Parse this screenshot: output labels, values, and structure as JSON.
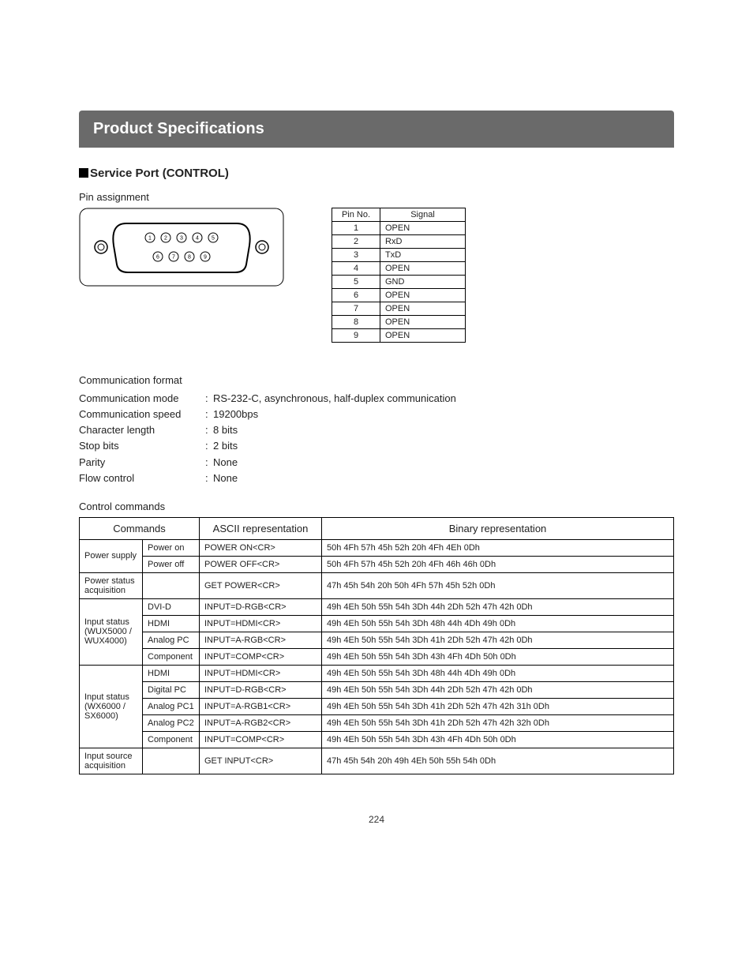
{
  "title": "Product Specifications",
  "section": "Service Port (CONTROL)",
  "pinAssignment": {
    "heading": "Pin assignment",
    "headers": {
      "pin": "Pin No.",
      "signal": "Signal"
    },
    "rows": [
      {
        "pin": "1",
        "signal": "OPEN"
      },
      {
        "pin": "2",
        "signal": "RxD"
      },
      {
        "pin": "3",
        "signal": "TxD"
      },
      {
        "pin": "4",
        "signal": "OPEN"
      },
      {
        "pin": "5",
        "signal": "GND"
      },
      {
        "pin": "6",
        "signal": "OPEN"
      },
      {
        "pin": "7",
        "signal": "OPEN"
      },
      {
        "pin": "8",
        "signal": "OPEN"
      },
      {
        "pin": "9",
        "signal": "OPEN"
      }
    ]
  },
  "commFormat": {
    "heading": "Communication format",
    "rows": [
      {
        "label": "Communication mode",
        "value": "RS-232-C, asynchronous, half-duplex communication"
      },
      {
        "label": "Communication speed",
        "value": "19200bps"
      },
      {
        "label": "Character length",
        "value": "8 bits"
      },
      {
        "label": "Stop bits",
        "value": "2 bits"
      },
      {
        "label": "Parity",
        "value": "None"
      },
      {
        "label": "Flow control",
        "value": "None"
      }
    ]
  },
  "controlCommands": {
    "heading": "Control commands",
    "headers": {
      "commands": "Commands",
      "ascii": "ASCII representation",
      "binary": "Binary representation"
    },
    "groups": [
      {
        "category": "Power supply",
        "rows": [
          {
            "sub": "Power on",
            "ascii": "POWER ON<CR>",
            "binary": "50h 4Fh 57h 45h 52h 20h 4Fh 4Eh 0Dh"
          },
          {
            "sub": "Power off",
            "ascii": "POWER OFF<CR>",
            "binary": "50h 4Fh 57h 45h 52h 20h 4Fh 46h 46h 0Dh"
          }
        ]
      },
      {
        "category": "Power status acquisition",
        "rows": [
          {
            "sub": "",
            "ascii": "GET POWER<CR>",
            "binary": "47h 45h 54h 20h 50h 4Fh 57h 45h 52h 0Dh"
          }
        ]
      },
      {
        "category": "Input status (WUX5000 / WUX4000)",
        "rows": [
          {
            "sub": "DVI-D",
            "ascii": "INPUT=D-RGB<CR>",
            "binary": "49h 4Eh 50h 55h 54h 3Dh 44h 2Dh 52h 47h 42h 0Dh"
          },
          {
            "sub": "HDMI",
            "ascii": "INPUT=HDMI<CR>",
            "binary": "49h 4Eh 50h 55h 54h 3Dh 48h 44h 4Dh 49h 0Dh"
          },
          {
            "sub": "Analog PC",
            "ascii": "INPUT=A-RGB<CR>",
            "binary": "49h 4Eh 50h 55h 54h 3Dh 41h 2Dh 52h 47h 42h 0Dh"
          },
          {
            "sub": "Component",
            "ascii": "INPUT=COMP<CR>",
            "binary": "49h 4Eh 50h 55h 54h 3Dh 43h 4Fh 4Dh 50h 0Dh"
          }
        ]
      },
      {
        "category": "Input status (WX6000 / SX6000)",
        "rows": [
          {
            "sub": "HDMI",
            "ascii": "INPUT=HDMI<CR>",
            "binary": "49h 4Eh 50h 55h 54h 3Dh 48h 44h 4Dh 49h 0Dh"
          },
          {
            "sub": "Digital PC",
            "ascii": "INPUT=D-RGB<CR>",
            "binary": "49h 4Eh 50h 55h 54h 3Dh 44h 2Dh 52h 47h 42h 0Dh"
          },
          {
            "sub": "Analog PC1",
            "ascii": "INPUT=A-RGB1<CR>",
            "binary": "49h 4Eh 50h 55h 54h 3Dh 41h 2Dh 52h 47h 42h 31h 0Dh"
          },
          {
            "sub": "Analog PC2",
            "ascii": "INPUT=A-RGB2<CR>",
            "binary": "49h 4Eh 50h 55h 54h 3Dh 41h 2Dh 52h 47h 42h 32h 0Dh"
          },
          {
            "sub": "Component",
            "ascii": "INPUT=COMP<CR>",
            "binary": "49h 4Eh 50h 55h 54h 3Dh 43h 4Fh 4Dh 50h 0Dh"
          }
        ]
      },
      {
        "category": "Input source acquisition",
        "rows": [
          {
            "sub": "",
            "ascii": "GET INPUT<CR>",
            "binary": "47h 45h 54h 20h 49h 4Eh 50h 55h 54h 0Dh"
          }
        ]
      }
    ]
  },
  "pageNumber": "224"
}
